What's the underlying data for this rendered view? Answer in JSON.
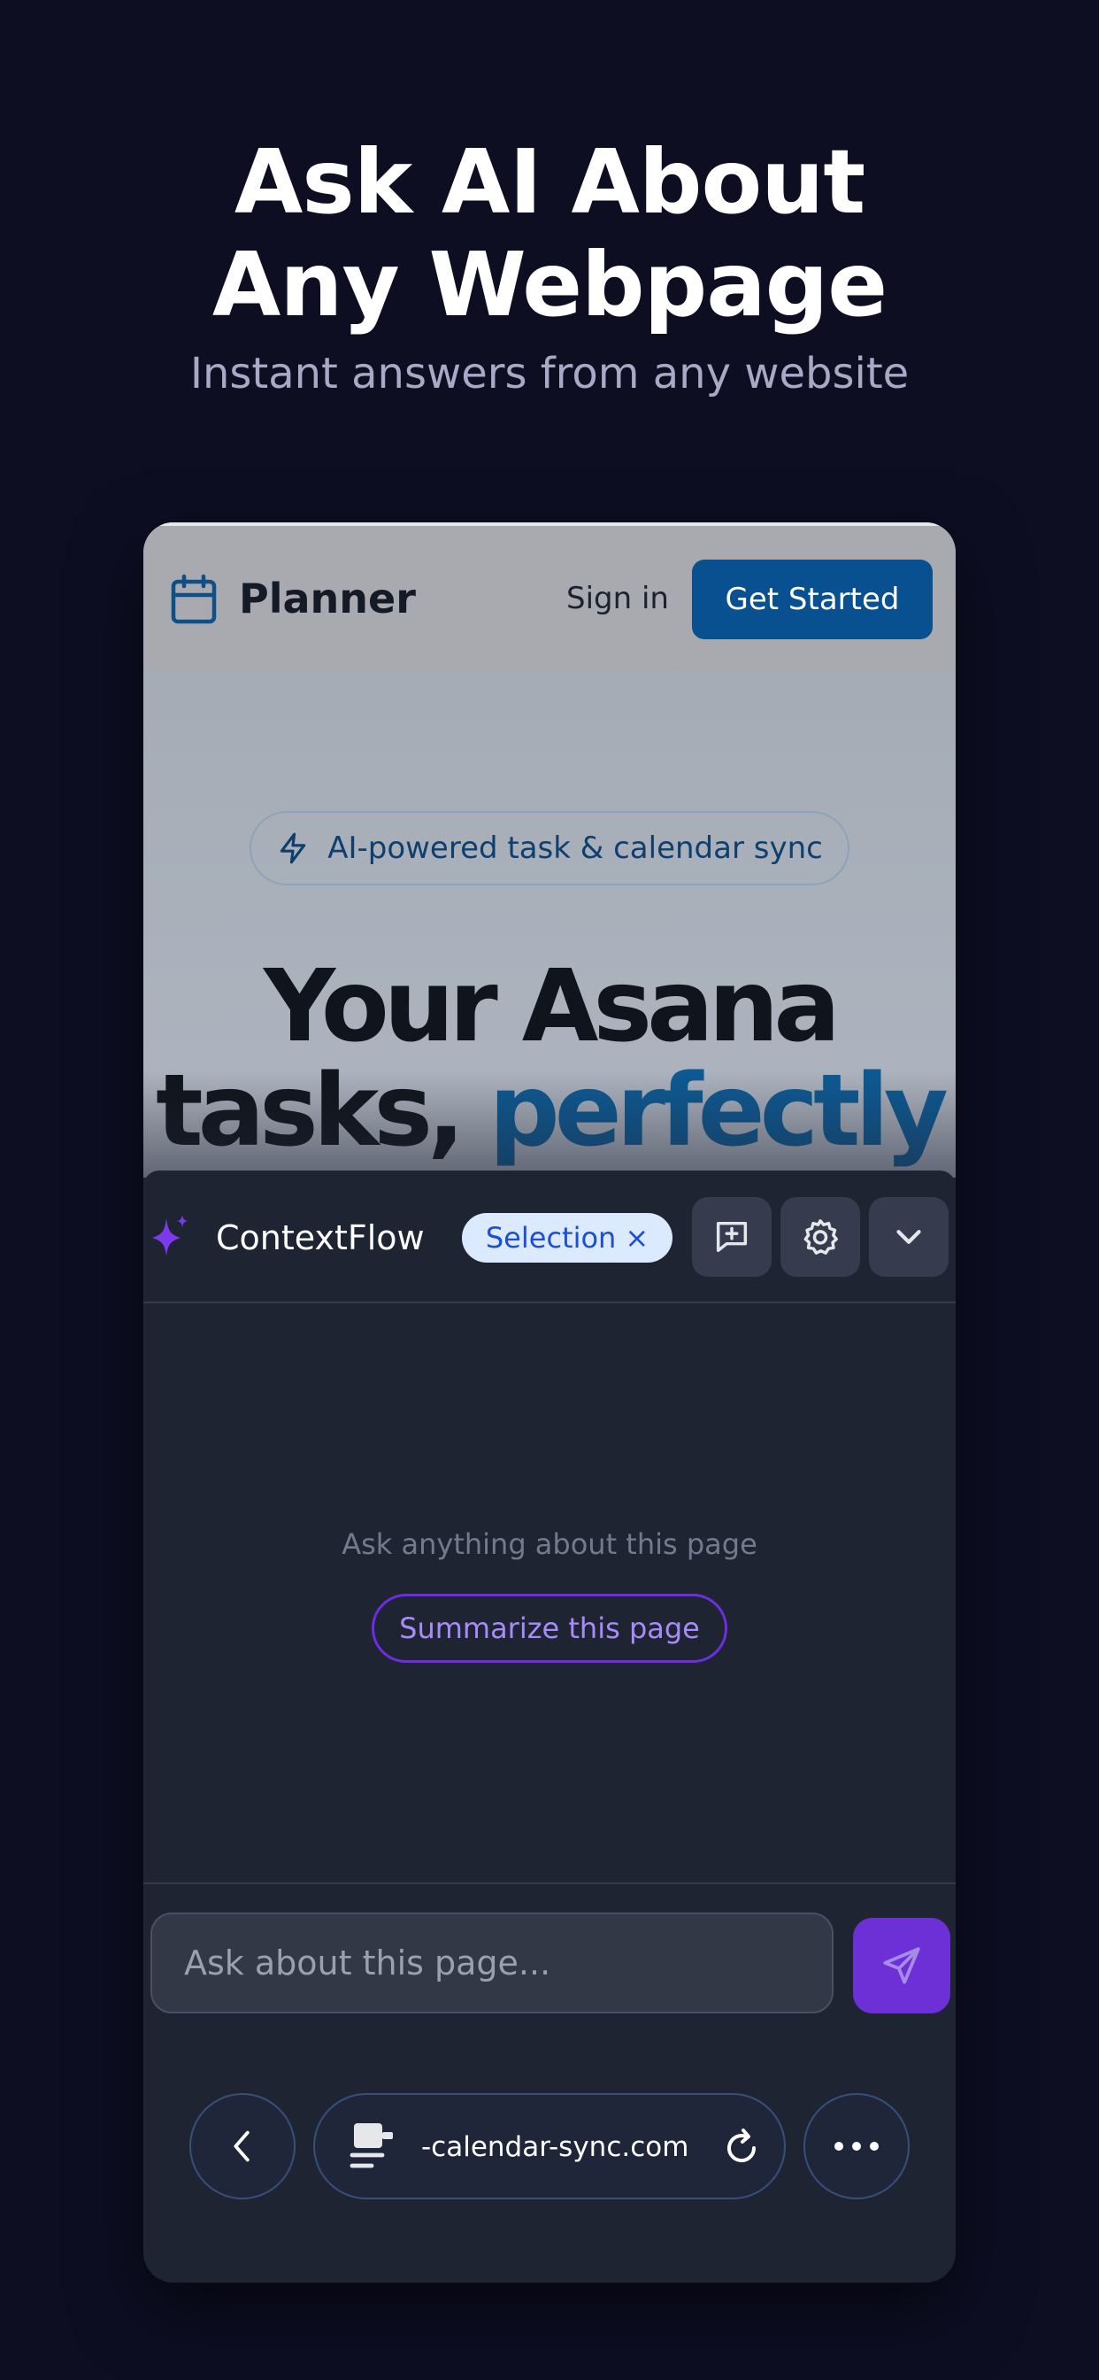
{
  "hero": {
    "title_line1": "Ask AI About",
    "title_line2": "Any Webpage",
    "subtitle": "Instant answers from any website"
  },
  "website": {
    "brand": "Planner",
    "sign_in": "Sign in",
    "cta": "Get Started",
    "badge": "AI-powered task & calendar sync",
    "headline_line1": "Your Asana",
    "headline_line2a": "tasks, ",
    "headline_line2b": "perfectly",
    "colors": {
      "cta": "#08508f",
      "accent": "#0d5a94"
    }
  },
  "assistant": {
    "title": "ContextFlow",
    "selection_chip": "Selection",
    "selection_close": "×",
    "empty_prompt": "Ask anything about this page",
    "summarize_label": "Summarize this page",
    "input_placeholder": "Ask about this page...",
    "colors": {
      "accent": "#6d2fd6",
      "chip_bg": "#dbeafe"
    },
    "icons": [
      "sparkle-icon",
      "new-chat-icon",
      "settings-icon",
      "chevron-down-icon",
      "send-icon"
    ]
  },
  "browser": {
    "url": "-calendar-sync.com",
    "icons": [
      "back-icon",
      "page-icon",
      "reload-icon",
      "more-icon"
    ]
  }
}
